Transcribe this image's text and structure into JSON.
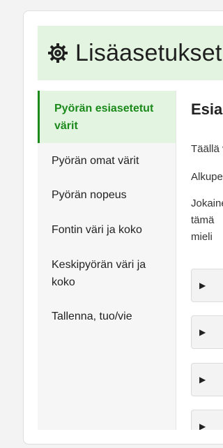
{
  "header": {
    "title": "Lisäasetukset",
    "gear_icon": "gear-icon"
  },
  "sidebar": {
    "items": [
      {
        "label": "Pyörän esiasetetut värit",
        "active": true
      },
      {
        "label": "Pyörän omat värit",
        "active": false
      },
      {
        "label": "Pyörän nopeus",
        "active": false
      },
      {
        "label": "Fontin väri ja koko",
        "active": false
      },
      {
        "label": "Keskipyörän väri ja koko",
        "active": false
      },
      {
        "label": "Tallenna, tuo/vie",
        "active": false
      }
    ]
  },
  "content": {
    "heading": "Esiasetetut värit",
    "paragraphs": [
      "Täällä voit valita",
      "Alkuperäiset",
      "Jokainen",
      "tämä",
      "mieli"
    ],
    "accordions": [
      {
        "arrow": "▶"
      },
      {
        "arrow": "▶"
      },
      {
        "arrow": "▶"
      },
      {
        "arrow": "▶"
      }
    ]
  },
  "colors": {
    "accent": "#1b8a1b",
    "accent_bg": "#e3f4e1"
  }
}
